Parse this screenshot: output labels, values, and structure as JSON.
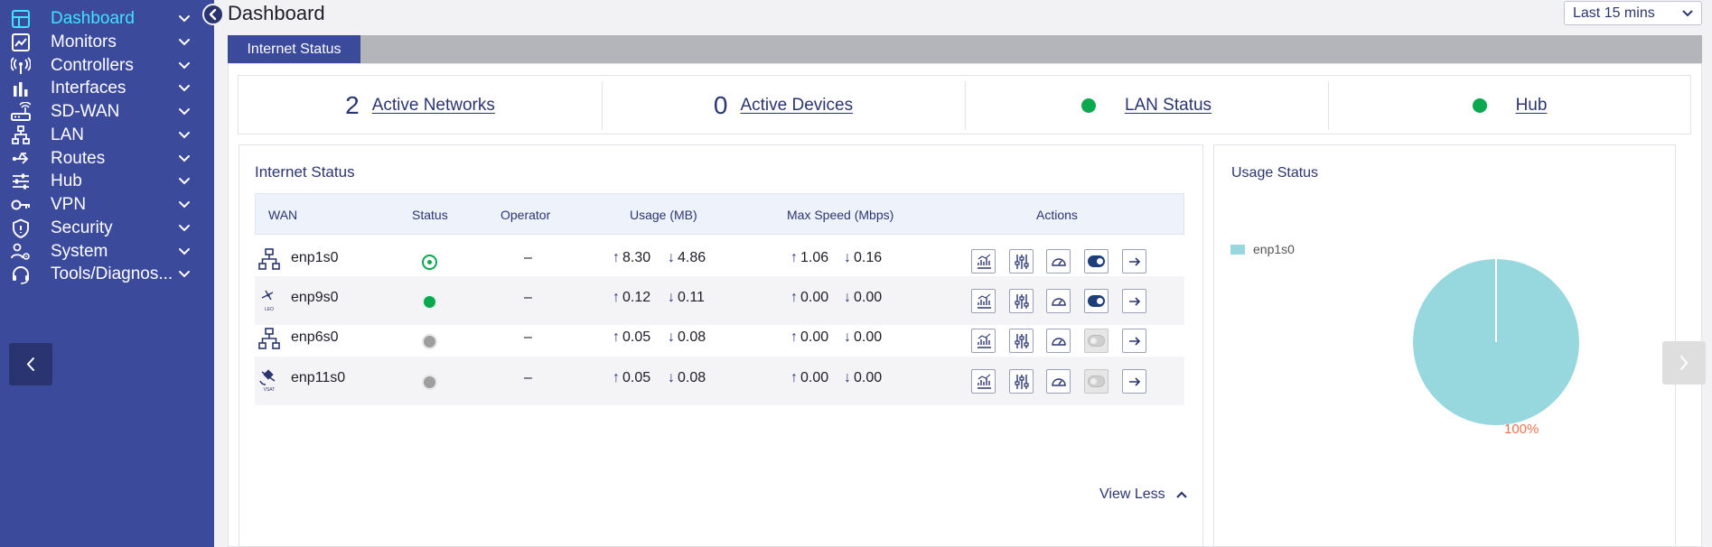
{
  "header": {
    "title": "Dashboard",
    "time_range": "Last 15 mins"
  },
  "sidebar": {
    "items": [
      {
        "label": "Dashboard",
        "icon": "dashboard-icon"
      },
      {
        "label": "Monitors",
        "icon": "chart-line-icon"
      },
      {
        "label": "Controllers",
        "icon": "antenna-icon"
      },
      {
        "label": "Interfaces",
        "icon": "bar-chart-icon"
      },
      {
        "label": "SD-WAN",
        "icon": "router-icon"
      },
      {
        "label": "LAN",
        "icon": "network-tree-icon"
      },
      {
        "label": "Routes",
        "icon": "routes-icon"
      },
      {
        "label": "Hub",
        "icon": "sliders-icon"
      },
      {
        "label": "VPN",
        "icon": "key-icon"
      },
      {
        "label": "Security",
        "icon": "shield-icon"
      },
      {
        "label": "System",
        "icon": "system-users-icon"
      },
      {
        "label": "Tools/Diagnos...",
        "icon": "headset-icon"
      }
    ],
    "active_color": "#3fe3ff"
  },
  "tabs": [
    {
      "label": "Internet Status"
    }
  ],
  "summary": {
    "active_networks": {
      "count": "2",
      "label": "Active Networks"
    },
    "active_devices": {
      "count": "0",
      "label": "Active Devices"
    },
    "lan_status": {
      "label": "LAN Status",
      "status_color": "#0aa84f"
    },
    "hub": {
      "label": "Hub",
      "status_color": "#0aa84f"
    }
  },
  "internet_status": {
    "title": "Internet Status",
    "columns": [
      "WAN",
      "Status",
      "Operator",
      "Usage (MB)",
      "Max Speed (Mbps)",
      "Actions"
    ],
    "rows": [
      {
        "wan": "enp1s0",
        "type_icon": "ethernet-icon",
        "type_label": "",
        "status": "active-ring",
        "operator": "–",
        "usage_up": "8.30",
        "usage_down": "4.86",
        "speed_up": "1.06",
        "speed_down": "0.16",
        "toggle": "on"
      },
      {
        "wan": "enp9s0",
        "type_icon": "leo-satellite-icon",
        "type_label": "LEO",
        "status": "online",
        "operator": "–",
        "usage_up": "0.12",
        "usage_down": "0.11",
        "speed_up": "0.00",
        "speed_down": "0.00",
        "toggle": "on"
      },
      {
        "wan": "enp6s0",
        "type_icon": "ethernet-icon",
        "type_label": "",
        "status": "offline",
        "operator": "–",
        "usage_up": "0.05",
        "usage_down": "0.08",
        "speed_up": "0.00",
        "speed_down": "0.00",
        "toggle": "off"
      },
      {
        "wan": "enp11s0",
        "type_icon": "vsat-satellite-icon",
        "type_label": "VSAT",
        "status": "offline",
        "operator": "–",
        "usage_up": "0.05",
        "usage_down": "0.08",
        "speed_up": "0.00",
        "speed_down": "0.00",
        "toggle": "off"
      }
    ],
    "view_less": "View Less"
  },
  "usage_status": {
    "title": "Usage Status",
    "legend": [
      {
        "label": "enp1s0",
        "color": "#96d8de"
      }
    ],
    "pie_label": "100%"
  },
  "chart_data": {
    "type": "pie",
    "title": "Usage Status",
    "categories": [
      "enp1s0"
    ],
    "values": [
      100
    ],
    "colors": [
      "#96d8de"
    ]
  }
}
